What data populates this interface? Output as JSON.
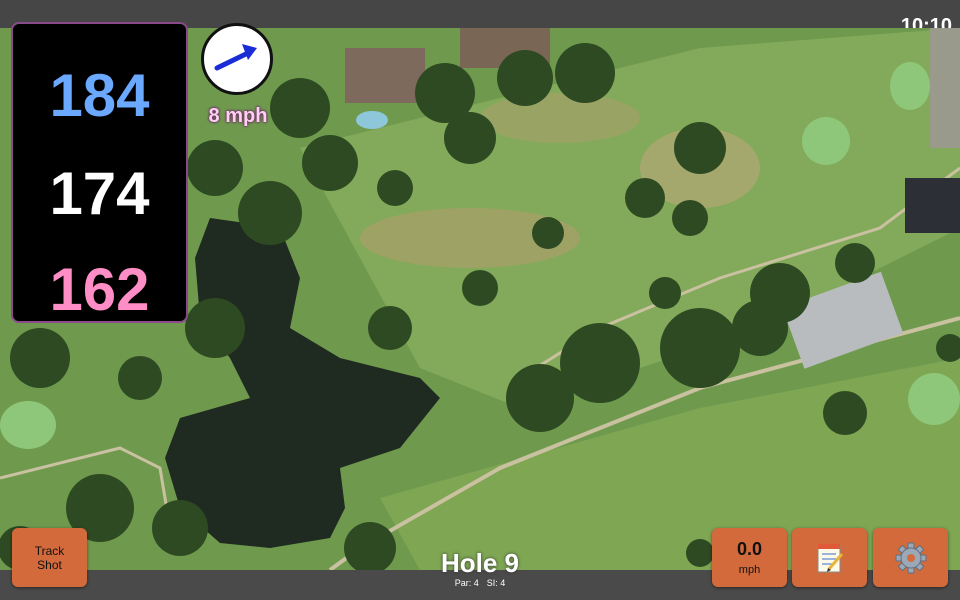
{
  "status_bar": {
    "time": "10:10"
  },
  "distances": {
    "back": "184",
    "middle": "174",
    "front": "162"
  },
  "wind": {
    "speed_label": "8 mph",
    "direction": "east-northeast"
  },
  "hole": {
    "title": "Hole 9",
    "par_label": "Par: 4",
    "si_label": "SI: 4"
  },
  "buttons": {
    "track_shot_line1": "Track",
    "track_shot_line2": "Shot",
    "speed_value": "0.0",
    "speed_unit": "mph",
    "notes_icon": "notepad-icon",
    "settings_icon": "gear-icon"
  },
  "colors": {
    "back_distance": "#6aa9ff",
    "middle_distance": "#ffffff",
    "front_distance": "#ff8ec6",
    "button": "#d36a3c",
    "wind_arrow": "#1a2cd6"
  }
}
